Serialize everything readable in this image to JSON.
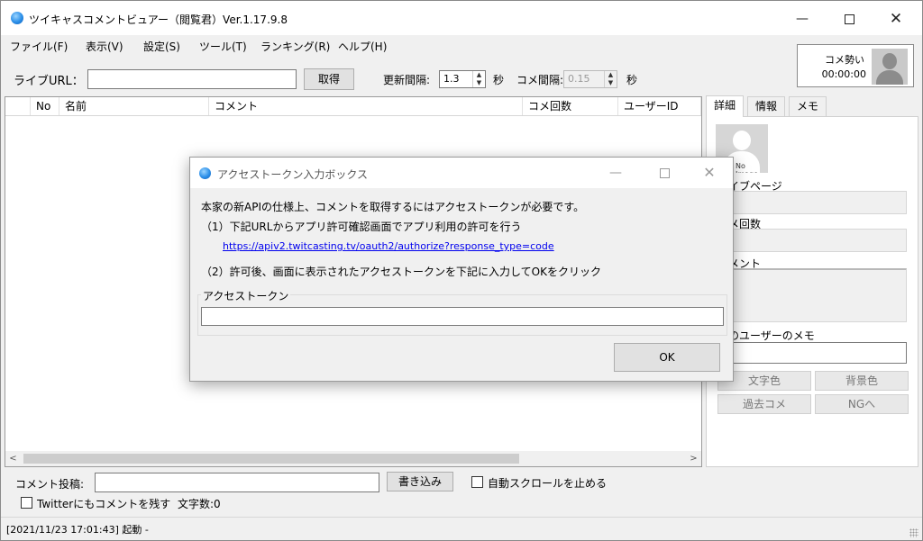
{
  "window": {
    "title": "ツイキャスコメントビュアー（閲覧君）Ver.1.17.9.8",
    "min_glyph": "—",
    "close_glyph": "✕"
  },
  "menu": [
    {
      "label": "ファイル(F)"
    },
    {
      "label": "表示(V)"
    },
    {
      "label": "設定(S)"
    },
    {
      "label": "ツール(T)"
    },
    {
      "label": "ランキング(R)"
    },
    {
      "label": "ヘルプ(H)"
    }
  ],
  "toolbar": {
    "live_url_label": "ライブURL：",
    "live_url_value": "",
    "fetch_button": "取得",
    "update_interval_label": "更新間隔:",
    "update_interval_value": "1.3",
    "seconds_1": "秒",
    "comment_interval_label": "コメ間隔:",
    "comment_interval_value": "0.15",
    "seconds_2": "秒"
  },
  "speed": {
    "label": "コメ勢い",
    "time": "00:00:00"
  },
  "list": {
    "columns": [
      "No",
      "名前",
      "コメント",
      "コメ回数",
      "ユーザーID"
    ],
    "scroll_left": "<",
    "scroll_right": ">"
  },
  "side": {
    "tabs": [
      "詳細",
      "情報",
      "メモ"
    ],
    "no_image_text": "No Image",
    "live_page_label": "ライブページ",
    "comment_count_label": "コメ回数",
    "comment_label": "コメント",
    "user_memo_label": "このユーザーのメモ",
    "text_color_button": "文字色",
    "bg_color_button": "背景色",
    "past_comments_button": "過去コメ",
    "ng_button": "NGへ"
  },
  "post": {
    "label": "コメント投稿:",
    "value": "",
    "write_button": "書き込み",
    "autoscroll_stop": "自動スクロールを止める",
    "twitter_label": "Twitterにもコメントを残す",
    "char_count": "文字数:0"
  },
  "status": {
    "text": "[2021/11/23 17:01:43] 起動 -"
  },
  "dialog": {
    "title": "アクセストークン入力ボックス",
    "min_glyph": "—",
    "close_glyph": "✕",
    "line1": "本家の新APIの仕様上、コメントを取得するにはアクセストークンが必要です。",
    "line2": "（1）下記URLからアプリ許可確認画面でアプリ利用の許可を行う",
    "link": "https://apiv2.twitcasting.tv/oauth2/authorize?response_type=code",
    "line3": "（2）許可後、画面に表示されたアクセストークンを下記に入力してOKをクリック",
    "token_label": "アクセストークン",
    "token_value": "",
    "ok_button": "OK"
  }
}
